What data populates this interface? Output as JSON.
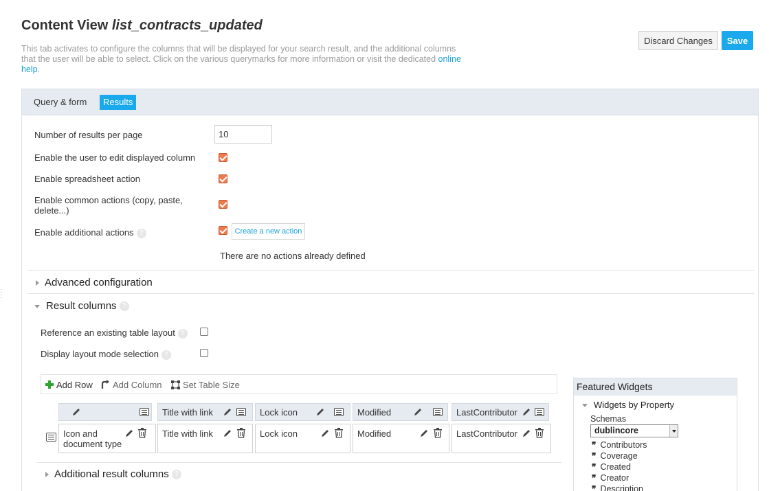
{
  "header": {
    "title_prefix": "Content View",
    "title_name": "list_contracts_updated",
    "description": "This tab activates to configure the columns that will be displayed for your search result, and the additional columns that the user will be able to select. Click on the various querymarks for more information or visit the dedicated ",
    "help_link": "online help",
    "description_end": ".",
    "discard_label": "Discard Changes",
    "save_label": "Save"
  },
  "tabs": [
    {
      "label": "Query & form",
      "active": false
    },
    {
      "label": "Results",
      "active": true
    }
  ],
  "settings": {
    "results_per_page_label": "Number of results per page",
    "results_per_page_value": "10",
    "edit_columns_label": "Enable the user to edit displayed column",
    "spreadsheet_label": "Enable spreadsheet action",
    "common_actions_label": "Enable common actions (copy, paste, delete...)",
    "additional_actions_label": "Enable additional actions",
    "create_action_label": "Create a new action",
    "no_actions_text": "There are no actions already defined"
  },
  "sections": {
    "advanced": "Advanced configuration",
    "result_columns": "Result columns",
    "additional_result_columns": "Additional result columns"
  },
  "result_columns": {
    "reference_layout_label": "Reference an existing table layout",
    "display_mode_label": "Display layout mode selection",
    "toolbar": {
      "add_row": "Add Row",
      "add_column": "Add Column",
      "set_table_size": "Set Table Size"
    },
    "headers": [
      "",
      "Title with link",
      "Lock icon",
      "Modified",
      "LastContributor"
    ],
    "cells": [
      "Icon and\ndocument type",
      "Title with link",
      "Lock icon",
      "Modified",
      "LastContributor"
    ]
  },
  "featured_widgets": {
    "title": "Featured Widgets",
    "group": "Widgets by Property",
    "schemas_label": "Schemas",
    "selected_schema": "dublincore",
    "items": [
      "Contributors",
      "Coverage",
      "Created",
      "Creator",
      "Description"
    ]
  },
  "colors": {
    "accent": "#1aa9ec",
    "checkbox": "#ec7a4f",
    "tabbar": "#e6ebf1"
  }
}
